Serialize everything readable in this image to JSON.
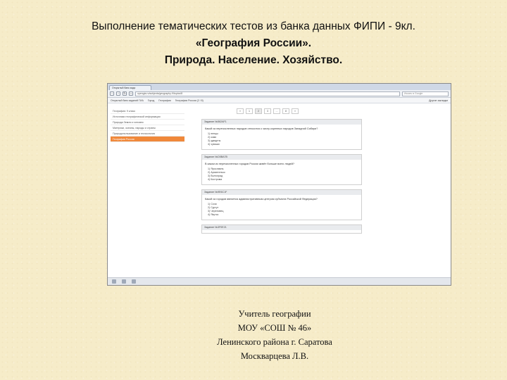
{
  "slide": {
    "title_line1": "Выполнение тематических тестов из банка данных  ФИПИ - 9кл.",
    "title_line2": "«География России».",
    "title_line3": "Природа. Население. Хозяйство."
  },
  "browser": {
    "tab_label": "Открытый банк зада",
    "url": "opengia.ru/subjects/geography-9/topics/8",
    "search_placeholder": "Искать в Google",
    "bookmarks": [
      "Открытый банк заданий ГИА",
      "Город",
      "География",
      "География России (2 / 8)"
    ],
    "bookmarks_right": "Другие закладки",
    "nav_icons": [
      "back-icon",
      "forward-icon",
      "reload-icon",
      "home-icon"
    ],
    "sidebar": [
      "География: 9 класс",
      "Источники географической информации",
      "Природа Земли и человек",
      "Материки, океаны, народы и страны",
      "Природопользование и геоэкология",
      "География России"
    ],
    "active_item_color": "#f0883a",
    "pager": [
      "«",
      "1",
      "2",
      "3",
      "...",
      "8",
      "»"
    ],
    "tasks": [
      {
        "head": "Задание №562AF1",
        "question": "Какой из перечисленных народов относится к числу коренных народов Западной Сибири?",
        "options": [
          "1) ненцы",
          "2) коми",
          "3) удмурты",
          "4) чуваши"
        ]
      },
      {
        "head": "Задание №D5BA7B",
        "question": "В каком из перечисленных городов России живёт больше всего людей?",
        "options": [
          "1) Ярославль",
          "2) Архангельск",
          "3) Волгоград",
          "4) Кострома"
        ]
      },
      {
        "head": "Задание №9E6C1F",
        "question": "Какой из городов является административным центром субъекта Российской Федерации?",
        "options": [
          "1) Сочи",
          "2) Сургут",
          "3) Череповец",
          "4) Якутск"
        ]
      },
      {
        "head": "Задание №3F0E21",
        "question": "",
        "options": []
      }
    ]
  },
  "author": {
    "line1": "Учитель географии",
    "line2": "МОУ «СОШ № 46»",
    "line3": "Ленинского района г. Саратова",
    "line4": "Москварцева Л.В."
  }
}
